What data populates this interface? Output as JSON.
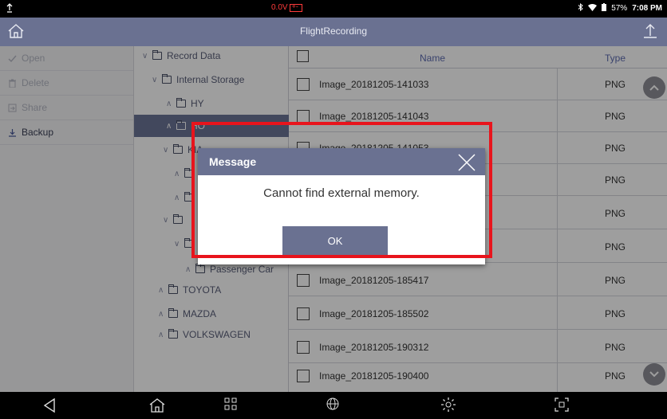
{
  "status_bar": {
    "left_icon": "upload-arrow-icon",
    "voltage": "0.0V",
    "battery_percent": "57%",
    "time": "7:08 PM"
  },
  "title_bar": {
    "title": "FlightRecording"
  },
  "left_menu": {
    "items": [
      {
        "label": "Open",
        "icon": "open-icon",
        "enabled": false
      },
      {
        "label": "Delete",
        "icon": "trash-icon",
        "enabled": false
      },
      {
        "label": "Share",
        "icon": "share-icon",
        "enabled": false
      },
      {
        "label": "Backup",
        "icon": "download-icon",
        "enabled": true
      }
    ]
  },
  "tree": {
    "nodes": [
      {
        "label": "Record Data",
        "expanded": true
      },
      {
        "label": "Internal Storage",
        "expanded": true
      },
      {
        "label": "HY",
        "expanded": false
      },
      {
        "label": "HO",
        "expanded": false,
        "selected": true
      },
      {
        "label": "KIA",
        "expanded": true
      },
      {
        "label": "",
        "expanded": false
      },
      {
        "label": "",
        "expanded": false
      },
      {
        "label": "",
        "expanded": true
      },
      {
        "label": "",
        "expanded": true
      },
      {
        "label": "Passenger Car",
        "expanded": false
      },
      {
        "label": "TOYOTA",
        "expanded": false
      },
      {
        "label": "MAZDA",
        "expanded": false
      },
      {
        "label": "VOLKSWAGEN",
        "expanded": false
      }
    ]
  },
  "file_list": {
    "columns": {
      "name": "Name",
      "type": "Type"
    },
    "rows": [
      {
        "name": "Image_20181205-141033",
        "type": "PNG"
      },
      {
        "name": "Image_20181205-141043",
        "type": "PNG"
      },
      {
        "name": "Image_20181205-141053",
        "type": "PNG"
      },
      {
        "name": "",
        "type": "PNG"
      },
      {
        "name": "",
        "type": "PNG"
      },
      {
        "name": "",
        "type": "PNG"
      },
      {
        "name": "Image_20181205-185417",
        "type": "PNG"
      },
      {
        "name": "Image_20181205-185502",
        "type": "PNG"
      },
      {
        "name": "Image_20181205-190312",
        "type": "PNG"
      },
      {
        "name": "Image_20181205-190400",
        "type": "PNG"
      }
    ]
  },
  "dialog": {
    "title": "Message",
    "message": "Cannot find external memory.",
    "ok_label": "OK"
  },
  "colors": {
    "header": "#6a7191",
    "selected": "#6b7496",
    "highlight": "#e8141c",
    "accent_text": "#5d6bb0"
  }
}
